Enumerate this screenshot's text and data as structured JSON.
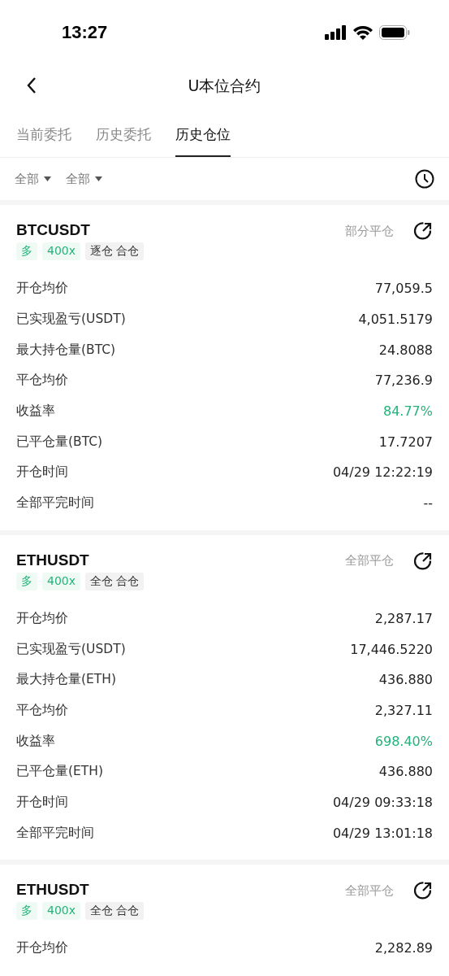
{
  "status_bar": {
    "time": "13:27"
  },
  "header": {
    "title": "U本位合约"
  },
  "tabs": [
    {
      "label": "当前委托",
      "selected": false
    },
    {
      "label": "历史委托",
      "selected": false
    },
    {
      "label": "历史仓位",
      "selected": true
    }
  ],
  "filters": [
    {
      "label": "全部"
    },
    {
      "label": "全部"
    }
  ],
  "positions": [
    {
      "symbol": "BTCUSDT",
      "status": "部分平仓",
      "tags": [
        {
          "label": "多",
          "kind": "accent"
        },
        {
          "label": "400x",
          "kind": "accent"
        },
        {
          "label": "逐仓 合仓",
          "kind": "neutral"
        }
      ],
      "rows": [
        {
          "label": "开仓均价",
          "value": "77,059.5",
          "kind": "plain"
        },
        {
          "label": "已实现盈亏(USDT)",
          "value": "4,051.5179",
          "kind": "plain"
        },
        {
          "label": "最大持仓量(BTC)",
          "value": "24.8088",
          "kind": "plain"
        },
        {
          "label": "平仓均价",
          "value": "77,236.9",
          "kind": "plain"
        },
        {
          "label": "收益率",
          "value": "84.77%",
          "kind": "positive"
        },
        {
          "label": "已平仓量(BTC)",
          "value": "17.7207",
          "kind": "plain"
        },
        {
          "label": "开仓时间",
          "value": "04/29 12:22:19",
          "kind": "plain"
        },
        {
          "label": "全部平完时间",
          "value": "--",
          "kind": "plain"
        }
      ]
    },
    {
      "symbol": "ETHUSDT",
      "status": "全部平仓",
      "tags": [
        {
          "label": "多",
          "kind": "accent"
        },
        {
          "label": "400x",
          "kind": "accent"
        },
        {
          "label": "全仓 合仓",
          "kind": "neutral"
        }
      ],
      "rows": [
        {
          "label": "开仓均价",
          "value": "2,287.17",
          "kind": "plain"
        },
        {
          "label": "已实现盈亏(USDT)",
          "value": "17,446.5220",
          "kind": "plain"
        },
        {
          "label": "最大持仓量(ETH)",
          "value": "436.880",
          "kind": "plain"
        },
        {
          "label": "平仓均价",
          "value": "2,327.11",
          "kind": "plain"
        },
        {
          "label": "收益率",
          "value": "698.40%",
          "kind": "positive"
        },
        {
          "label": "已平仓量(ETH)",
          "value": "436.880",
          "kind": "plain"
        },
        {
          "label": "开仓时间",
          "value": "04/29 09:33:18",
          "kind": "plain"
        },
        {
          "label": "全部平完时间",
          "value": "04/29 13:01:18",
          "kind": "plain"
        }
      ]
    },
    {
      "symbol": "ETHUSDT",
      "status": "全部平仓",
      "tags": [
        {
          "label": "多",
          "kind": "accent"
        },
        {
          "label": "400x",
          "kind": "accent"
        },
        {
          "label": "全仓 合仓",
          "kind": "neutral"
        }
      ],
      "rows": [
        {
          "label": "开仓均价",
          "value": "2,282.89",
          "kind": "plain"
        }
      ]
    }
  ]
}
